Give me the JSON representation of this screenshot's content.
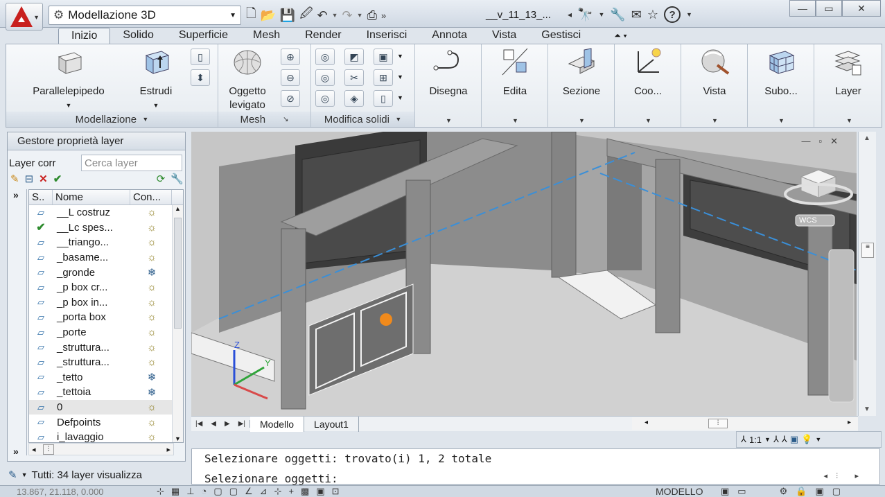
{
  "titlebar": {
    "workspace": "Modellazione 3D",
    "doc_title": "__v_11_13_...",
    "minimize": "—",
    "restore": "▭",
    "close": "✕"
  },
  "ribbon": {
    "tabs": [
      "Inizio",
      "Solido",
      "Superficie",
      "Mesh",
      "Render",
      "Inserisci",
      "Annota",
      "Vista",
      "Gestisci"
    ],
    "active_tab": "Inizio",
    "panels": {
      "modellazione": {
        "title": "Modellazione",
        "parallelepipedo": "Parallelepipedo",
        "estrudi": "Estrudi"
      },
      "mesh": {
        "title": "Mesh",
        "oggetto_levigato_1": "Oggetto",
        "oggetto_levigato_2": "levigato"
      },
      "modifica_solidi": {
        "title": "Modifica solidi"
      },
      "disegna": "Disegna",
      "edita": "Edita",
      "sezione": "Sezione",
      "coo": "Coo...",
      "vista": "Vista",
      "subo": "Subo...",
      "layer": "Layer"
    }
  },
  "layer_palette": {
    "title": "Gestore proprietà layer",
    "current_layer_label": "Layer corr",
    "search_placeholder": "Cerca layer",
    "columns": {
      "status": "S..",
      "name": "Nome",
      "on": "Con..."
    },
    "layers": [
      {
        "name": "__L costruz",
        "current": false,
        "frozen": false
      },
      {
        "name": "__Lc spes...",
        "current": true,
        "frozen": false
      },
      {
        "name": "__triango...",
        "current": false,
        "frozen": false
      },
      {
        "name": "_basame...",
        "current": false,
        "frozen": false
      },
      {
        "name": "_gronde",
        "current": false,
        "frozen": true
      },
      {
        "name": "_p box cr...",
        "current": false,
        "frozen": false
      },
      {
        "name": "_p box in...",
        "current": false,
        "frozen": false
      },
      {
        "name": "_porta box",
        "current": false,
        "frozen": false
      },
      {
        "name": "_porte",
        "current": false,
        "frozen": false
      },
      {
        "name": "_struttura...",
        "current": false,
        "frozen": false
      },
      {
        "name": "_struttura...",
        "current": false,
        "frozen": false
      },
      {
        "name": "_tetto",
        "current": false,
        "frozen": true
      },
      {
        "name": "_tettoia",
        "current": false,
        "frozen": true
      },
      {
        "name": "0",
        "current": false,
        "frozen": false
      },
      {
        "name": "Defpoints",
        "current": false,
        "frozen": false
      },
      {
        "name": "i_lavaggio",
        "current": false,
        "frozen": false
      }
    ],
    "status_text": "Tutti: 34 layer visualizza"
  },
  "viewport": {
    "viewcube_wcs": "WCS",
    "axis_x": "X",
    "axis_y": "Y",
    "axis_z": "Z"
  },
  "layout_tabs": [
    "Modello",
    "Layout1"
  ],
  "annotation_scale": "1:1",
  "command_line": {
    "line1": "Selezionare oggetti: trovato(i) 1, 2 totale",
    "line2": "Selezionare oggetti:"
  },
  "status_bar": {
    "coords": "13.867, 21.118, 0.000",
    "mode": "MODELLO"
  },
  "colors": {
    "accent": "#c8201e",
    "ribbon_bg": "#eef2f6",
    "viewport_bg": "#c9c9c9"
  }
}
